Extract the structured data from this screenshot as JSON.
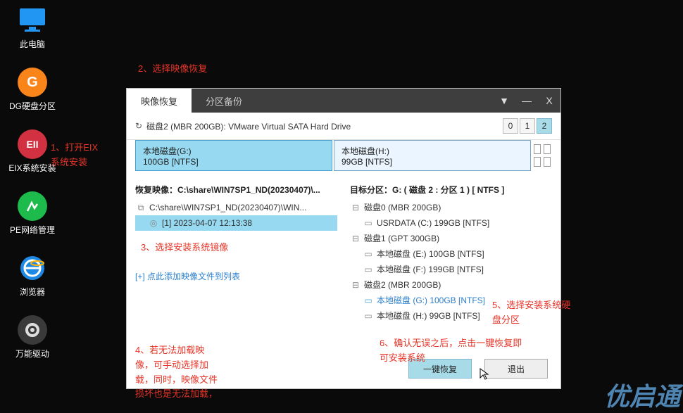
{
  "desktop": {
    "pc": "此电脑",
    "dg": "DG硬盘分区",
    "eix": "EIX系统安装",
    "eix_badge": "EII",
    "pe": "PE网络管理",
    "browser": "浏览器",
    "driver": "万能驱动",
    "dg_badge": "G"
  },
  "annotations": {
    "a1": "1、打开EIX\n系统安装",
    "a2": "2、选择映像恢复",
    "a3": "3、选择安装系统镜像",
    "a4": "4、若无法加载映\n像，可手动选择加\n载，同时，映像文件\n损坏也是无法加载，",
    "a5": "5、选择安装系统硬\n盘分区",
    "a6": "6、确认无误之后，点击一键恢复即\n可安装系统"
  },
  "dialog": {
    "tabs": {
      "restore": "映像恢复",
      "backup": "分区备份"
    },
    "title_dropdown": "▼",
    "title_min": "—",
    "title_close": "X",
    "diskline": "磁盘2 (MBR 200GB): VMware Virtual SATA Hard Drive",
    "disknums": [
      "0",
      "1",
      "2"
    ],
    "partitions": {
      "g_name": "本地磁盘(G:)",
      "g_size": "100GB [NTFS]",
      "h_name": "本地磁盘(H:)",
      "h_size": "99GB [NTFS]"
    },
    "left": {
      "head": "恢复映像：C:\\share\\WIN7SP1_ND(20230407)\\...",
      "path": "C:\\share\\WIN7SP1_ND(20230407)\\WIN...",
      "image": "[1] 2023-04-07 12:13:38",
      "addlink": "[+] 点此添加映像文件到列表"
    },
    "right": {
      "head": "目标分区：G: ( 磁盘 2 : 分区 1 ) [ NTFS ]",
      "d0": "磁盘0 (MBR 200GB)",
      "d0p1": "USRDATA (C:) 199GB [NTFS]",
      "d1": "磁盘1 (GPT 300GB)",
      "d1p1": "本地磁盘 (E:) 100GB [NTFS]",
      "d1p2": "本地磁盘 (F:) 199GB [NTFS]",
      "d2": "磁盘2 (MBR 200GB)",
      "d2p1": "本地磁盘 (G:) 100GB [NTFS]",
      "d2p2": "本地磁盘 (H:) 99GB [NTFS]"
    },
    "buttons": {
      "restore": "一键恢复",
      "exit": "退出"
    }
  },
  "watermark": "优启通"
}
